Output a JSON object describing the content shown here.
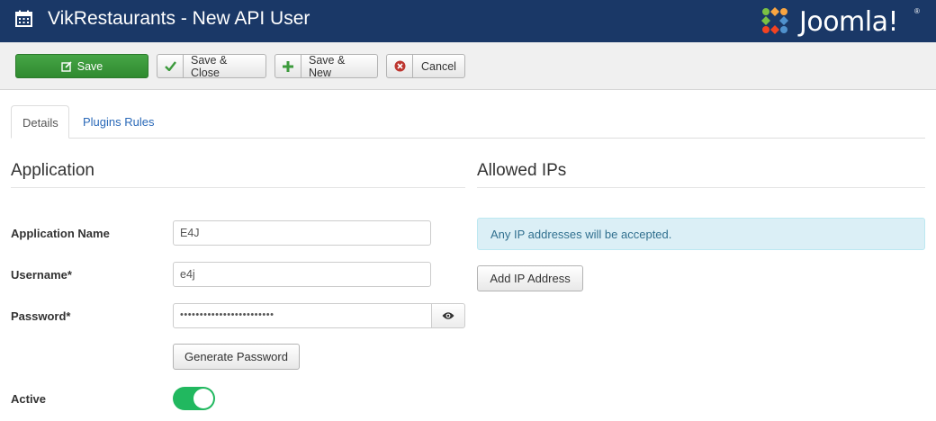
{
  "header": {
    "title": "VikRestaurants - New API User",
    "logo_text": "Joomla!",
    "logo_reg": "®"
  },
  "toolbar": {
    "save_label": "Save",
    "save_close_label": "Save & Close",
    "save_new_label": "Save & New",
    "cancel_label": "Cancel"
  },
  "tabs": [
    {
      "label": "Details"
    },
    {
      "label": "Plugins Rules"
    }
  ],
  "application": {
    "section_title": "Application",
    "app_name_label": "Application Name",
    "app_name_value": "E4J",
    "username_label": "Username*",
    "username_value": "e4j",
    "password_label": "Password*",
    "password_value": "••••••••••••••••••••••••",
    "generate_label": "Generate Password",
    "active_label": "Active",
    "active_on": true
  },
  "allowed_ips": {
    "section_title": "Allowed IPs",
    "notice": "Any IP addresses will be accepted.",
    "add_label": "Add IP Address"
  },
  "colors": {
    "header_bg": "#1a3867",
    "save_green": "#3c9a3c",
    "toggle_green": "#21b85f",
    "link_blue": "#2a69b8",
    "alert_bg": "#dbeff6"
  },
  "icons": {
    "header": "calendar-icon",
    "save": "edit-icon",
    "save_close": "check-icon",
    "save_new": "plus-icon",
    "cancel": "cancel-circle-icon",
    "password_toggle": "eye-icon"
  }
}
